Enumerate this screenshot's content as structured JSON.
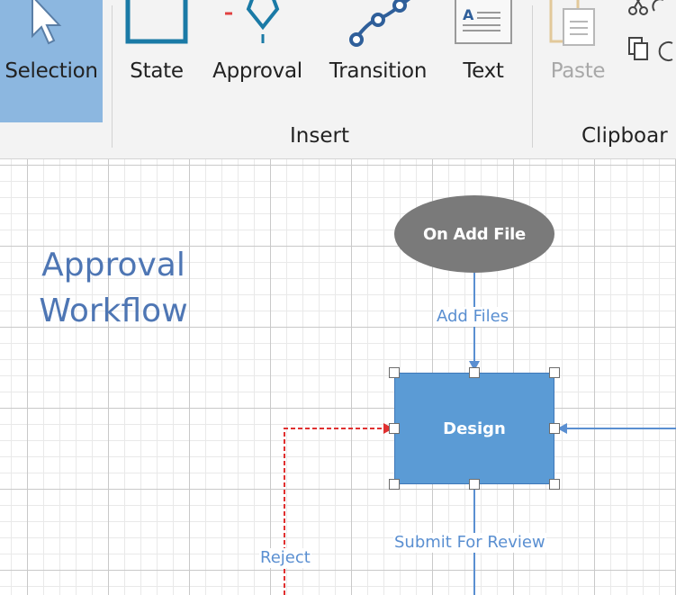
{
  "ribbon": {
    "buttons": {
      "selection": "Selection",
      "state": "State",
      "approval": "Approval",
      "transition": "Transition",
      "text": "Text",
      "paste": "Paste"
    },
    "groups": {
      "insert": "Insert",
      "clipboard": "Clipboar"
    },
    "selected_tool": "Selection",
    "colors": {
      "selected_bg": "#8cb7e0",
      "icon_teal": "#1a7aa6",
      "icon_blue": "#2f5f9a",
      "disabled": "#a8a8a8"
    }
  },
  "canvas": {
    "title": {
      "line1": "Approval",
      "line2": "Workflow"
    },
    "nodes": {
      "start": "On Add File",
      "design": "Design"
    },
    "edges": {
      "add_files": "Add Files",
      "submit_for_review": "Submit For Review",
      "reject": "Reject"
    },
    "colors": {
      "start_fill": "#7a7a7a",
      "state_fill": "#5b9bd5",
      "connector": "#5a8fd1",
      "reject_connector": "#e03030",
      "title": "#4e76b4"
    }
  }
}
